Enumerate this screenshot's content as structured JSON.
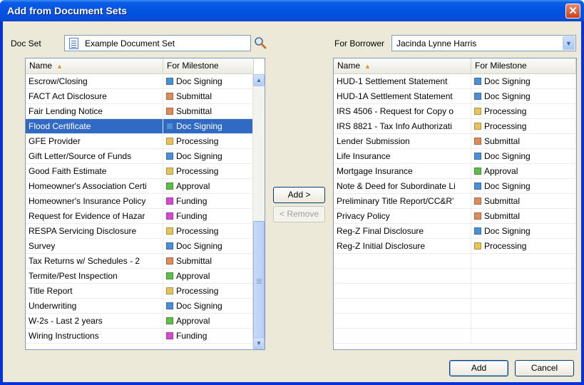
{
  "window": {
    "title": "Add from Document Sets",
    "close_glyph": "✕"
  },
  "docset": {
    "label": "Doc Set",
    "value": "Example Document Set",
    "icon": "document-icon",
    "search_icon": "search-icon"
  },
  "borrower": {
    "label": "For Borrower",
    "value": "Jacinda Lynne Harris",
    "dropdown_glyph": "▼"
  },
  "columns": {
    "name": "Name",
    "milestone": "For Milestone",
    "sort_glyph": "▲"
  },
  "milestone_colors": {
    "Doc Signing": "#4a90d9",
    "Submittal": "#e08a5a",
    "Processing": "#e8c35a",
    "Approval": "#5cbf4a",
    "Funding": "#d44ad0"
  },
  "left_list": [
    {
      "name": "Escrow/Closing",
      "milestone": "Doc Signing"
    },
    {
      "name": "FACT Act Disclosure",
      "milestone": "Submittal"
    },
    {
      "name": "Fair Lending Notice",
      "milestone": "Submittal"
    },
    {
      "name": "Flood Certificate",
      "milestone": "Doc Signing",
      "selected": true
    },
    {
      "name": "GFE Provider",
      "milestone": "Processing"
    },
    {
      "name": "Gift Letter/Source of Funds",
      "milestone": "Doc Signing"
    },
    {
      "name": "Good Faith Estimate",
      "milestone": "Processing"
    },
    {
      "name": "Homeowner's Association Certi",
      "milestone": "Approval"
    },
    {
      "name": "Homeowner's Insurance Policy",
      "milestone": "Funding"
    },
    {
      "name": "Request for Evidence of Hazar",
      "milestone": "Funding"
    },
    {
      "name": "RESPA Servicing Disclosure",
      "milestone": "Processing"
    },
    {
      "name": "Survey",
      "milestone": "Doc Signing"
    },
    {
      "name": "Tax Returns w/ Schedules - 2",
      "milestone": "Submittal"
    },
    {
      "name": "Termite/Pest Inspection",
      "milestone": "Approval"
    },
    {
      "name": "Title Report",
      "milestone": "Processing"
    },
    {
      "name": "Underwriting",
      "milestone": "Doc Signing"
    },
    {
      "name": "W-2s - Last 2 years",
      "milestone": "Approval"
    },
    {
      "name": "Wiring Instructions",
      "milestone": "Funding"
    }
  ],
  "right_list": [
    {
      "name": "HUD-1 Settlement Statement",
      "milestone": "Doc Signing"
    },
    {
      "name": "HUD-1A Settlement Statement",
      "milestone": "Doc Signing"
    },
    {
      "name": "IRS 4506 - Request for Copy o",
      "milestone": "Processing"
    },
    {
      "name": "IRS 8821 - Tax Info Authorizati",
      "milestone": "Processing"
    },
    {
      "name": "Lender Submission",
      "milestone": "Submittal"
    },
    {
      "name": "Life Insurance",
      "milestone": "Doc Signing"
    },
    {
      "name": "Mortgage Insurance",
      "milestone": "Approval"
    },
    {
      "name": "Note & Deed for Subordinate Li",
      "milestone": "Doc Signing"
    },
    {
      "name": "Preliminary Title Report/CC&R'",
      "milestone": "Submittal"
    },
    {
      "name": "Privacy Policy",
      "milestone": "Submittal"
    },
    {
      "name": "Reg-Z Final Disclosure",
      "milestone": "Doc Signing"
    },
    {
      "name": "Reg-Z Initial Disclosure",
      "milestone": "Processing"
    }
  ],
  "buttons": {
    "add_move": "Add >",
    "remove": "< Remove",
    "add": "Add",
    "cancel": "Cancel"
  },
  "scrollbar": {
    "up_glyph": "▲",
    "down_glyph": "▼"
  }
}
